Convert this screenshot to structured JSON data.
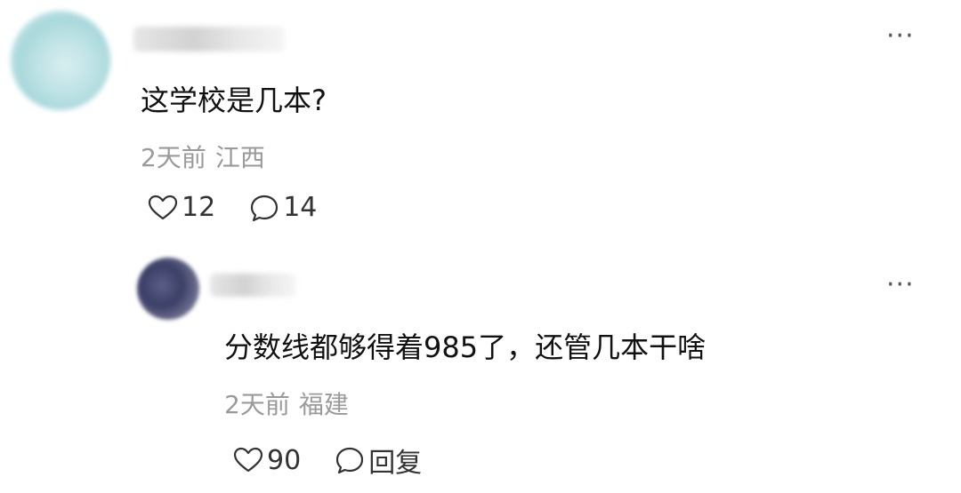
{
  "comment": {
    "text": "这学校是几本?",
    "time": "2天前",
    "location": "江西",
    "likes": "12",
    "replies": "14",
    "more_icon": "more-icon"
  },
  "reply": {
    "text": "分数线都够得着985了，还管几本干啥",
    "time": "2天前",
    "location": "福建",
    "likes": "90",
    "reply_label": "回复",
    "more_icon": "more-icon"
  }
}
